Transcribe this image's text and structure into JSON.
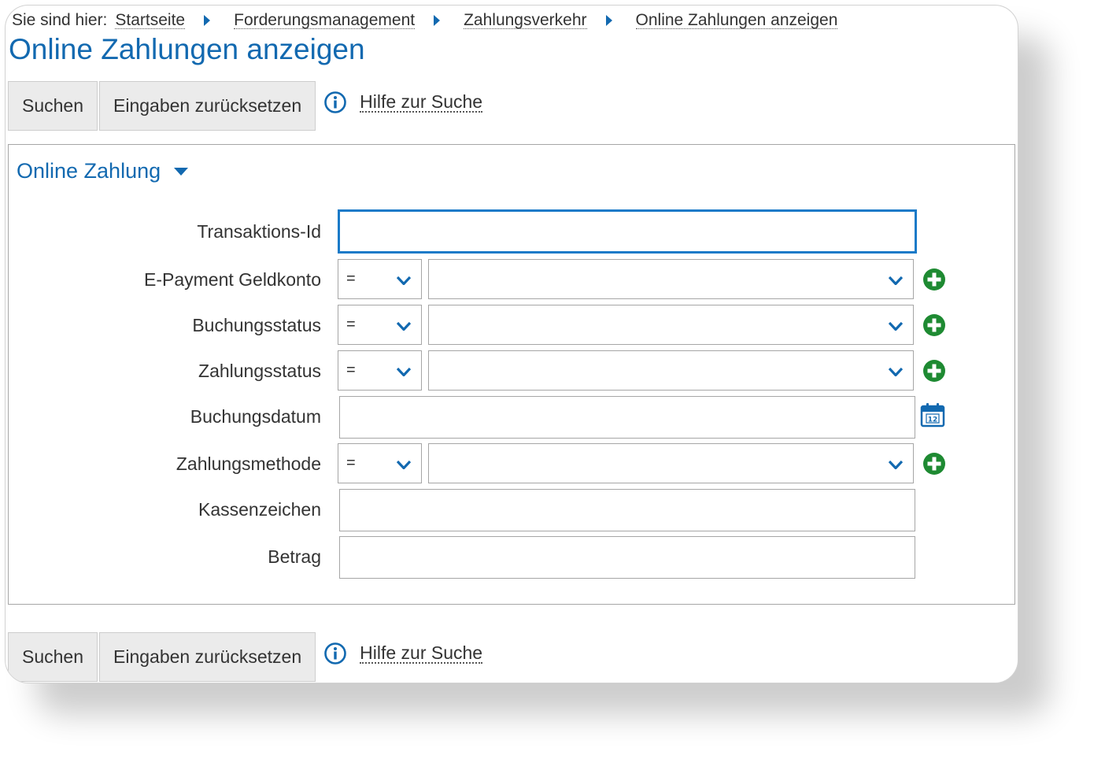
{
  "breadcrumb": {
    "prefix": "Sie sind hier:",
    "items": [
      "Startseite",
      "Forderungsmanagement",
      "Zahlungsverkehr",
      "Online Zahlungen anzeigen"
    ]
  },
  "page_title": "Online Zahlungen anzeigen",
  "toolbar": {
    "search_label": "Suchen",
    "reset_label": "Eingaben zurücksetzen",
    "help_label": "Hilfe zur Suche"
  },
  "panel": {
    "title": "Online Zahlung",
    "fields": {
      "transaktions_id": {
        "label": "Transaktions-Id",
        "value": ""
      },
      "epayment_geldkonto": {
        "label": "E-Payment Geldkonto",
        "operator": "=",
        "value": ""
      },
      "buchungsstatus": {
        "label": "Buchungsstatus",
        "operator": "=",
        "value": ""
      },
      "zahlungsstatus": {
        "label": "Zahlungsstatus",
        "operator": "=",
        "value": ""
      },
      "buchungsdatum": {
        "label": "Buchungsdatum",
        "value": ""
      },
      "zahlungsmethode": {
        "label": "Zahlungsmethode",
        "operator": "=",
        "value": ""
      },
      "kassenzeichen": {
        "label": "Kassenzeichen",
        "value": ""
      },
      "betrag": {
        "label": "Betrag",
        "value": ""
      }
    }
  },
  "colors": {
    "accent": "#1269b0",
    "add_green": "#1e8a32",
    "focus_border": "#1a7ac8"
  },
  "icons": {
    "breadcrumb_separator": "chevron-right-icon",
    "help": "info-icon",
    "panel_toggle": "caret-down-icon",
    "select_arrow": "chevron-down-icon",
    "add": "plus-circle-icon",
    "date": "calendar-icon"
  }
}
